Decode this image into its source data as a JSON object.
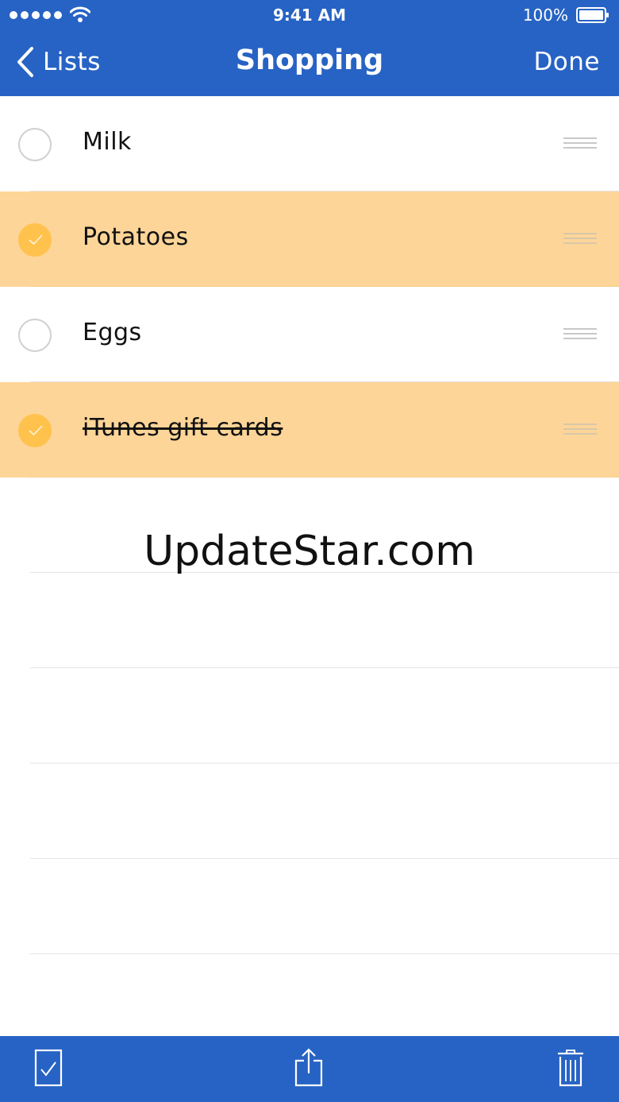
{
  "status_bar": {
    "time": "9:41 AM",
    "battery_percent": "100%",
    "signal_icon": "cellular-signal-icon",
    "wifi_icon": "wifi-icon",
    "battery_icon": "battery-icon"
  },
  "nav": {
    "back_label": "Lists",
    "title": "Shopping",
    "done_label": "Done",
    "back_icon": "chevron-left-icon"
  },
  "items": [
    {
      "label": "Milk",
      "checked": false
    },
    {
      "label": "Potatoes",
      "checked": true
    },
    {
      "label": "Eggs",
      "checked": false
    },
    {
      "label": "iTunes gift cards",
      "checked": true,
      "struck": true
    }
  ],
  "watermark": "UpdateStar.com",
  "toolbar": {
    "check_icon": "check-all-icon",
    "share_icon": "share-icon",
    "trash_icon": "trash-icon"
  },
  "colors": {
    "brand": "#2763c4",
    "checked_row": "#fed598",
    "checkbox_checked": "#ffc24d",
    "checkbox_empty_border": "#d0d0d0"
  }
}
